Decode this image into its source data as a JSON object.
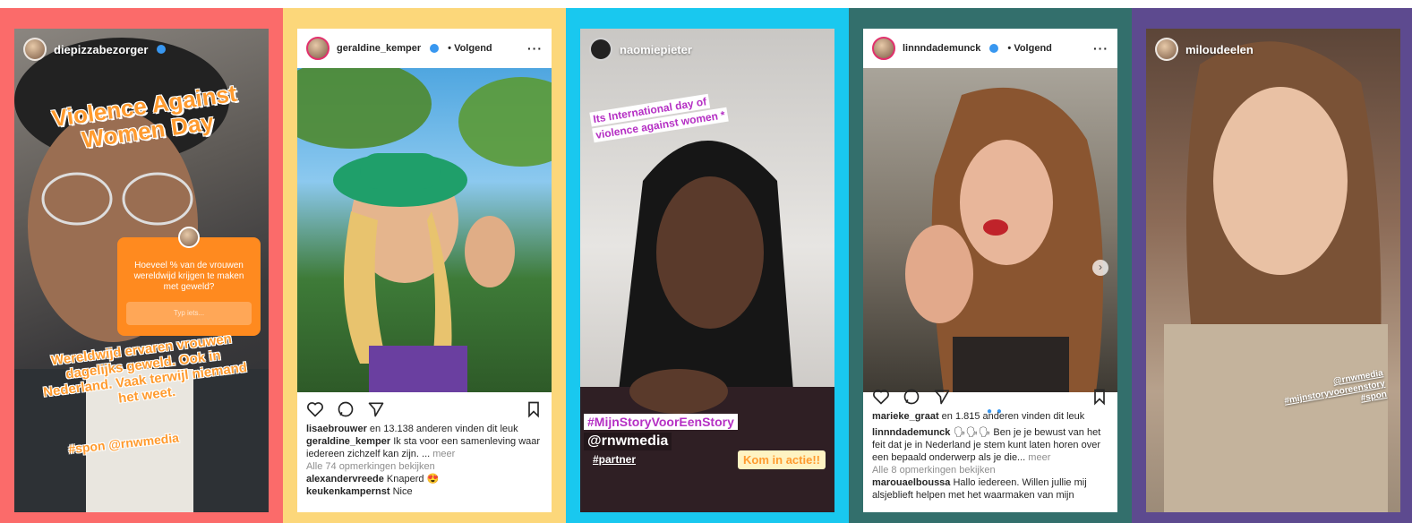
{
  "colors": {
    "panel1": "#fb6b6a",
    "panel2": "#fcd77a",
    "panel3": "#19c8ef",
    "panel4": "#336f6c",
    "panel5": "#5d4a8f"
  },
  "panel1": {
    "username": "diepizzabezorger",
    "title": "Violence Against Women Day",
    "question": "Hoeveel % van de vrouwen wereldwijd krijgen te maken met geweld?",
    "input_placeholder": "Typ iets...",
    "body": "Wereldwijd ervaren vrouwen dagelijks geweld. Ook in Nederland. Vaak terwijl niemand het weet.",
    "tags": "#spon @rnwmedia"
  },
  "panel2": {
    "username": "geraldine_kemper",
    "follow": "• Volgend",
    "more": "···",
    "likes_user": "lisaebrouwer",
    "likes_rest": " en 13.138 anderen vinden dit leuk",
    "caption_user": "geraldine_kemper",
    "caption_text": " Ik sta voor een samenleving waar iedereen zichzelf kan zijn. ... ",
    "caption_more": "meer",
    "view_comments": "Alle 74 opmerkingen bekijken",
    "comment1_user": "alexandervreede",
    "comment1_text": " Knaperd 😍",
    "comment2_user": "keukenkampernst",
    "comment2_text": " Nice"
  },
  "panel3": {
    "username": "naomiepieter",
    "sticker_line1": "Its International day of",
    "sticker_line2": "violence against women *",
    "hashtag": "#MijnStoryVoorEenStory",
    "mention": "@rnwmedia",
    "partner": "#partner",
    "cta": "Kom in actie!!"
  },
  "panel4": {
    "username": "linnndademunck",
    "follow": "• Volgend",
    "more": "···",
    "likes_user": "marieke_graat",
    "likes_rest": " en 1.815 anderen vinden dit leuk",
    "caption_user": "linnndademunck",
    "caption_text": " 🗣🗣🗣 Ben je je bewust van het feit dat je in Nederland je stem kunt laten horen over een bepaald onderwerp als je die... ",
    "caption_more": "meer",
    "view_comments": "Alle 8 opmerkingen bekijken",
    "comment1_user": "marouaelboussa",
    "comment1_text": " Hallo iedereen. Willen jullie mij alsjeblieft helpen met het waarmaken van mijn"
  },
  "panel5": {
    "username": "miloudeelen",
    "tag1": "@rnwmedia",
    "tag2": "#mijnstoryvooreenstory",
    "tag3": "#spon"
  }
}
